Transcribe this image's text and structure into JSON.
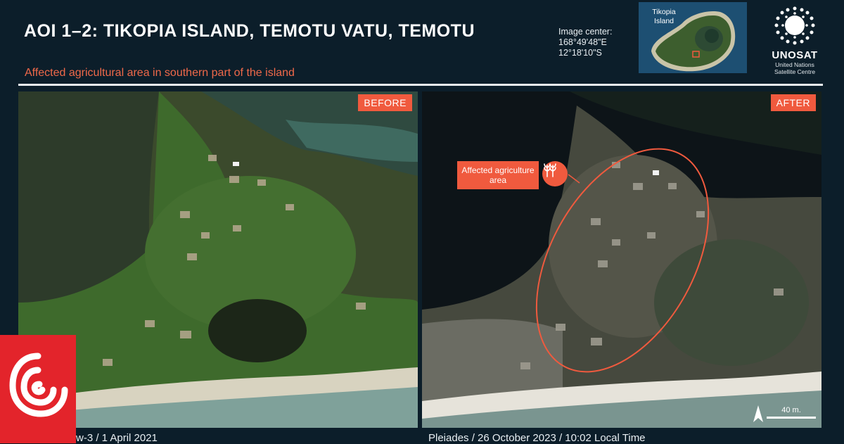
{
  "header": {
    "title": "AOI 1–2: TIKOPIA ISLAND, TEMOTU VATU, TEMOTU",
    "subtitle": "Affected agricultural area in southern part of the island"
  },
  "image_center": {
    "label": "Image center:",
    "lon": "168°49'48\"E",
    "lat": "12°18'10\"S"
  },
  "inset_map": {
    "label": "Tikopia Island"
  },
  "logo": {
    "name": "UNOSAT",
    "line1": "United Nations",
    "line2": "Satellite Centre"
  },
  "panels": {
    "before": {
      "tag": "BEFORE",
      "caption": "w-3 / 1 April 2021"
    },
    "after": {
      "tag": "AFTER",
      "caption": "Pleiades / 26 October 2023 / 10:02 Local Time",
      "callout": "Affected agriculture area",
      "scale": "40 m."
    }
  },
  "colors": {
    "accent": "#f05a3e",
    "background": "#0c1e2a",
    "broadcaster_red": "#e3242b"
  },
  "icons": [
    "wheat-icon",
    "north-arrow-icon",
    "unosat-logo-icon",
    "rnz-logo-icon"
  ]
}
